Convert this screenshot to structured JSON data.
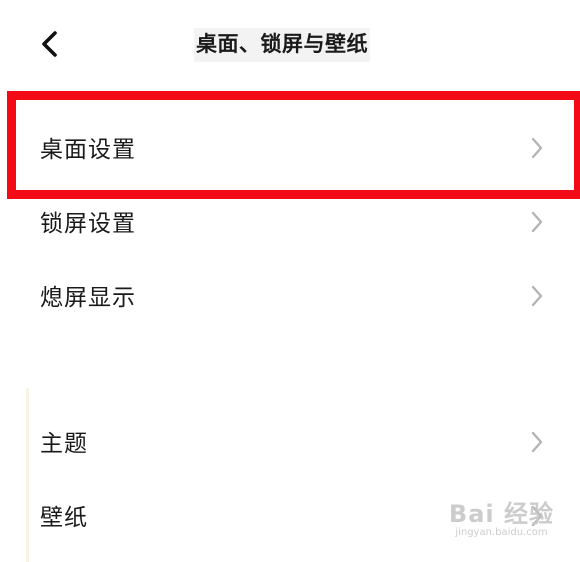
{
  "header": {
    "title": "桌面、锁屏与壁纸",
    "back_icon": "chevron-left-icon"
  },
  "highlight_color": "#f20a17",
  "groups": [
    {
      "items": [
        {
          "label": "桌面设置",
          "icon": "chevron-right-icon",
          "highlighted": true
        },
        {
          "label": "锁屏设置",
          "icon": "chevron-right-icon"
        },
        {
          "label": "熄屏显示",
          "icon": "chevron-right-icon"
        }
      ]
    },
    {
      "items": [
        {
          "label": "主题",
          "icon": "chevron-right-icon"
        },
        {
          "label": "壁纸",
          "icon": "chevron-right-icon"
        }
      ]
    }
  ],
  "watermark": {
    "main": "Bai 经验",
    "sub": "jingyan.baidu.com"
  }
}
